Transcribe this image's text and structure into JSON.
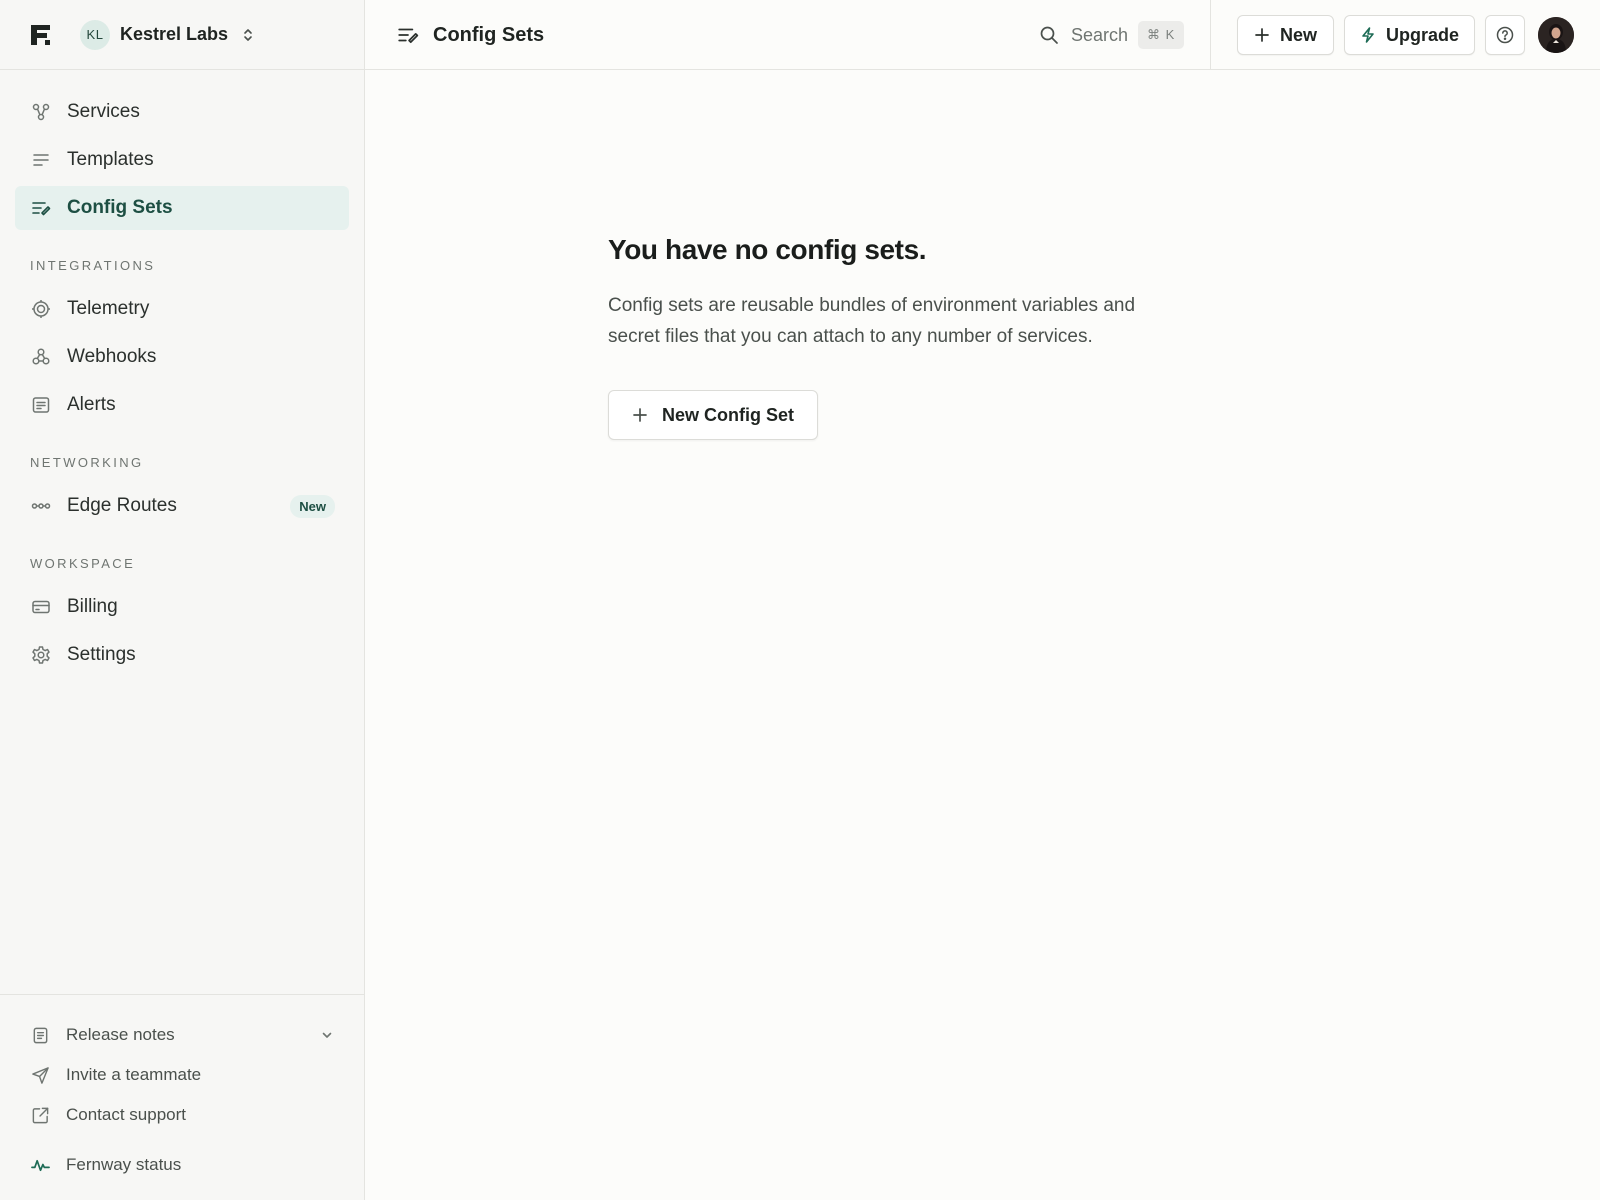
{
  "workspace": {
    "initials": "KL",
    "name": "Kestrel Labs"
  },
  "sidebar": {
    "primary": [
      {
        "label": "Services",
        "icon": "services-icon"
      },
      {
        "label": "Templates",
        "icon": "templates-icon"
      },
      {
        "label": "Config Sets",
        "icon": "config-sets-icon",
        "active": true
      }
    ],
    "sections": [
      {
        "label": "INTEGRATIONS",
        "items": [
          {
            "label": "Telemetry",
            "icon": "telemetry-icon"
          },
          {
            "label": "Webhooks",
            "icon": "webhooks-icon"
          },
          {
            "label": "Alerts",
            "icon": "alerts-icon"
          }
        ]
      },
      {
        "label": "NETWORKING",
        "items": [
          {
            "label": "Edge Routes",
            "icon": "edge-routes-icon",
            "badge": "New"
          }
        ]
      },
      {
        "label": "WORKSPACE",
        "items": [
          {
            "label": "Billing",
            "icon": "billing-icon"
          },
          {
            "label": "Settings",
            "icon": "gear-icon"
          }
        ]
      }
    ],
    "footer": [
      {
        "label": "Release notes",
        "icon": "release-notes-icon"
      },
      {
        "label": "Invite a teammate",
        "icon": "send-icon"
      },
      {
        "label": "Contact support",
        "icon": "external-link-icon"
      },
      {
        "label": "Fernway status",
        "icon": "activity-icon"
      }
    ]
  },
  "topbar": {
    "title": "Config Sets",
    "search_label": "Search",
    "search_shortcut": "⌘ K",
    "new_label": "New",
    "upgrade_label": "Upgrade"
  },
  "empty_state": {
    "title": "You have no config sets.",
    "description": "Config sets are reusable bundles of environment variables and secret files that you can attach to any number of services.",
    "cta_label": "New Config Set"
  },
  "colors": {
    "accent": "#1d4f43",
    "accent_bg": "#e6f1ee",
    "sidebar_bg": "#f7f7f5",
    "page_bg": "#fcfcfa"
  }
}
